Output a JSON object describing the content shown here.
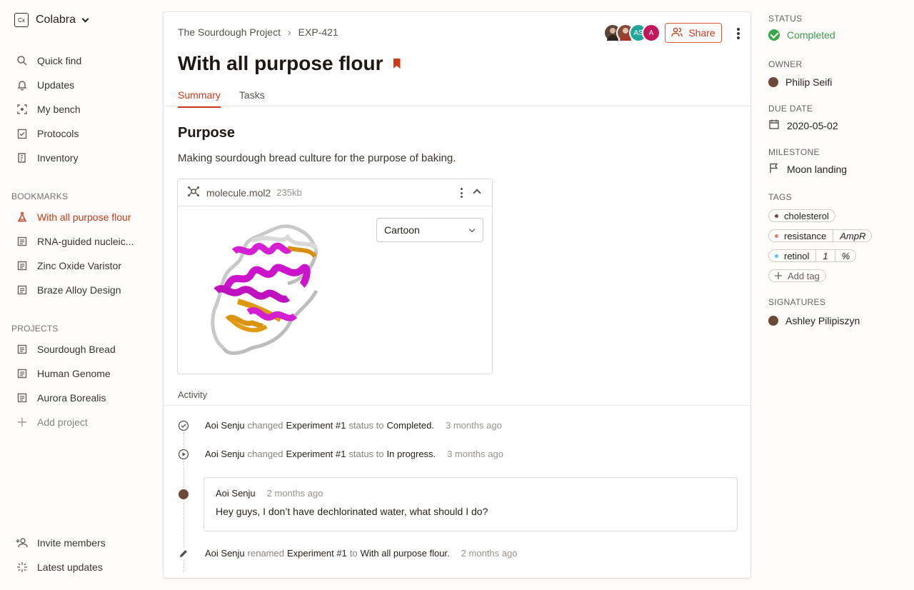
{
  "workspace": {
    "name": "Colabra",
    "logo_text": "Cx"
  },
  "nav": [
    {
      "label": "Quick find",
      "icon": "search-icon"
    },
    {
      "label": "Updates",
      "icon": "bell-icon"
    },
    {
      "label": "My bench",
      "icon": "bench-icon"
    },
    {
      "label": "Protocols",
      "icon": "clipboard-check-icon"
    },
    {
      "label": "Inventory",
      "icon": "inventory-icon"
    }
  ],
  "bookmarks": {
    "label": "BOOKMARKS",
    "items": [
      {
        "label": "With all purpose flour",
        "icon": "flask-icon",
        "active": true
      },
      {
        "label": "RNA-guided nucleic...",
        "icon": "document-icon"
      },
      {
        "label": "Zinc Oxide Varistor",
        "icon": "document-icon"
      },
      {
        "label": "Braze Alloy Design",
        "icon": "document-icon"
      }
    ]
  },
  "projects": {
    "label": "PROJECTS",
    "items": [
      {
        "label": "Sourdough Bread",
        "icon": "document-icon"
      },
      {
        "label": "Human Genome",
        "icon": "document-icon"
      },
      {
        "label": "Aurora Borealis",
        "icon": "document-icon"
      }
    ],
    "add_label": "Add project"
  },
  "footer": {
    "invite_label": "Invite members",
    "latest_label": "Latest updates"
  },
  "header": {
    "breadcrumb": [
      "The Sourdough Project",
      "EXP-421"
    ],
    "separator": "›",
    "avatars": [
      {
        "initials": "",
        "color": "#5b4638"
      },
      {
        "initials": "",
        "color": "#8a4a3a"
      },
      {
        "initials": "AS",
        "color": "#23a69a"
      },
      {
        "initials": "A",
        "color": "#c2185b"
      }
    ],
    "share_label": "Share"
  },
  "experiment": {
    "title": "With all purpose flour",
    "tabs": [
      "Summary",
      "Tasks"
    ],
    "purpose_heading": "Purpose",
    "purpose_text": "Making sourdough bread culture for the purpose of baking."
  },
  "attachment": {
    "filename": "molecule.mol2",
    "size": "235kb",
    "view_mode": "Cartoon"
  },
  "activity": {
    "heading": "Activity",
    "events": [
      {
        "user": "Aoi Senju",
        "verb": "changed",
        "object": "Experiment #1",
        "mid": "status to",
        "value": "Completed.",
        "time": "3 months ago"
      },
      {
        "user": "Aoi Senju",
        "verb": "changed",
        "object": "Experiment #1",
        "mid": "status to",
        "value": "In progress.",
        "time": "3 months ago"
      }
    ],
    "comment": {
      "user": "Aoi Senju",
      "time": "2 months ago",
      "text": "Hey guys, I don’t have dechlorinated water, what should I do?"
    },
    "rename": {
      "user": "Aoi Senju",
      "verb": "renamed",
      "object": "Experiment #1",
      "mid": "to",
      "value": "With all purpose flour.",
      "time": "2 months ago"
    }
  },
  "details": {
    "status_label": "STATUS",
    "status_value": "Completed",
    "owner_label": "OWNER",
    "owner_value": "Philip Seifi",
    "due_label": "DUE DATE",
    "due_value": "2020-05-02",
    "milestone_label": "MILESTONE",
    "milestone_value": "Moon landing",
    "tags_label": "TAGS",
    "tags": [
      {
        "name": "cholesterol",
        "color": "#6b4a52"
      },
      {
        "name": "resistance",
        "value": "AmpR",
        "color": "#e07a5f"
      },
      {
        "name": "retinol",
        "value": "1",
        "unit": "%",
        "color": "#4fc3f7"
      }
    ],
    "add_tag_label": "Add tag",
    "signatures_label": "SIGNATURES",
    "signature_value": "Ashley Pilipiszyn"
  },
  "colors": {
    "accent": "#cc3a16",
    "success": "#3aa84a"
  }
}
